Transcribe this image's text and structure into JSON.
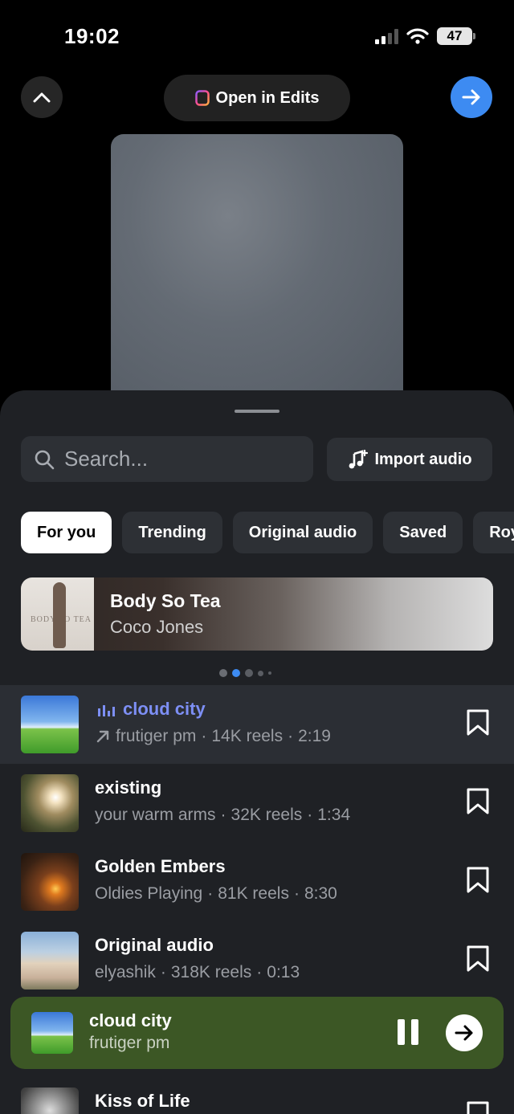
{
  "status_bar": {
    "time": "19:02",
    "battery": "47"
  },
  "top_bar": {
    "open_in_edits": "Open in Edits"
  },
  "sheet": {
    "search_placeholder": "Search...",
    "import_audio": "Import audio",
    "tabs": [
      "For you",
      "Trending",
      "Original audio",
      "Saved",
      "Roya"
    ],
    "featured": {
      "title": "Body So Tea",
      "artist": "Coco Jones",
      "art_text": "BODY SO TEA"
    },
    "tracks": [
      {
        "title": "cloud city",
        "artist": "frutiger pm",
        "reels": "14K reels",
        "duration": "2:19",
        "playing": true
      },
      {
        "title": "existing",
        "artist": "your warm arms",
        "reels": "32K reels",
        "duration": "1:34"
      },
      {
        "title": "Golden Embers",
        "artist": "Oldies Playing",
        "reels": "81K reels",
        "duration": "8:30"
      },
      {
        "title": "Original audio",
        "artist": "elyashik",
        "reels": "318K reels",
        "duration": "0:13"
      },
      {
        "title": "Kiss of Life"
      }
    ],
    "separator": "·"
  },
  "now_playing": {
    "title": "cloud city",
    "artist": "frutiger pm"
  },
  "colors": {
    "accent_blue": "#3d8bf2",
    "playing_purple": "#7d8ff5",
    "now_playing_bg": "#3c5725",
    "sheet_bg": "#1f2125"
  }
}
